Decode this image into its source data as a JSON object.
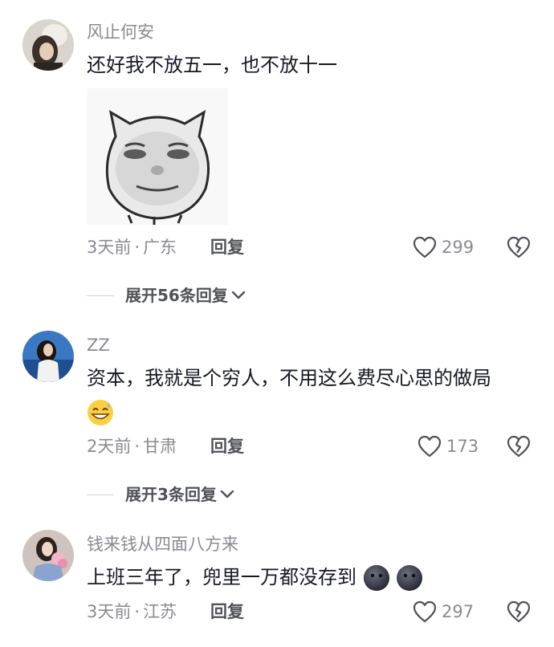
{
  "comments": [
    {
      "username": "风止何安",
      "text": "还好我不放五一，也不放十一",
      "time": "3天前",
      "dot": "·",
      "location": "广东",
      "reply_label": "回复",
      "likes": "299",
      "expand_label": "展开56条回复",
      "sticker_icon": "meme-face-sticker"
    },
    {
      "username": "ZZ",
      "text": "资本，我就是个穷人，不用这么费尽心思的做局",
      "time": "2天前",
      "dot": "·",
      "location": "甘肃",
      "reply_label": "回复",
      "likes": "173",
      "expand_label": "展开3条回复",
      "emoji_icon": "grin-sweat-emoji"
    },
    {
      "username": "钱来钱从四面八方来",
      "text": "上班三年了，兜里一万都没存到",
      "time": "3天前",
      "dot": "·",
      "location": "江苏",
      "reply_label": "回复",
      "likes": "297",
      "emoji_icon": "dark-blob-emoji"
    }
  ],
  "colors": {
    "primary_text": "#161823",
    "secondary_text": "#8a8b91",
    "action_text": "#505258",
    "background": "#ffffff"
  }
}
